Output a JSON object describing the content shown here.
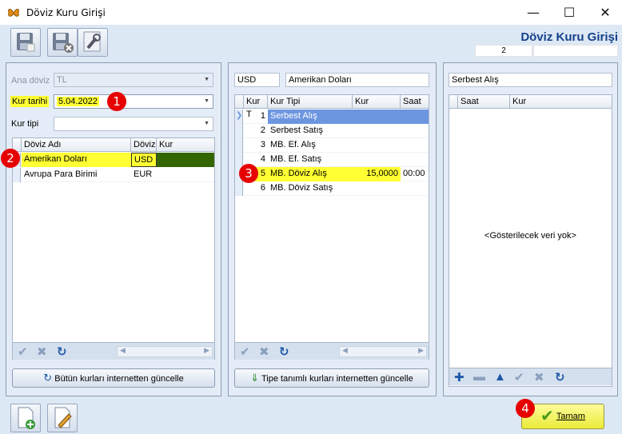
{
  "window": {
    "title": "Döviz Kuru Girişi"
  },
  "header": {
    "form_title": "Döviz Kuru Girişi",
    "record_number": "2"
  },
  "left": {
    "ana_doviz_label": "Ana döviz",
    "ana_doviz_value": "TL",
    "kur_tarihi_label": "Kur tarihi",
    "kur_tarihi_value": "5.04.2022",
    "kur_tipi_label": "Kur tipi",
    "kur_tipi_value": "",
    "columns": [
      "Döviz Adı",
      "Döviz",
      "Kur"
    ],
    "rows": [
      {
        "name": "Amerikan Doları",
        "code": "USD",
        "rate": ""
      },
      {
        "name": "Avrupa Para Birimi",
        "code": "EUR",
        "rate": ""
      }
    ],
    "update_all_button": "Bütün kurları internetten güncelle"
  },
  "middle": {
    "currency_code": "USD",
    "currency_name": "Amerikan Doları",
    "columns": [
      "Kur T",
      "Kur Tipi",
      "Kur",
      "Saat"
    ],
    "rows": [
      {
        "no": "1",
        "type": "Serbest Alış",
        "rate": "",
        "time": ""
      },
      {
        "no": "2",
        "type": "Serbest Satış",
        "rate": "",
        "time": ""
      },
      {
        "no": "3",
        "type": "MB. Ef. Alış",
        "rate": "",
        "time": ""
      },
      {
        "no": "4",
        "type": "MB. Ef. Satış",
        "rate": "",
        "time": ""
      },
      {
        "no": "5",
        "type": "MB. Döviz Alış",
        "rate": "15,0000",
        "time": "00:00"
      },
      {
        "no": "6",
        "type": "MB. Döviz Satış",
        "rate": "",
        "time": ""
      }
    ],
    "update_typed_button": "Tipe tanımlı kurları internetten güncelle"
  },
  "right": {
    "selected_type": "Serbest Alış",
    "columns": [
      "Saat",
      "Kur"
    ],
    "empty_text": "<Gösterilecek veri yok>"
  },
  "footer": {
    "ok_button": "Tamam"
  },
  "badges": [
    "1",
    "2",
    "3",
    "4"
  ],
  "colors": {
    "highlight": "#ffff33",
    "selected_rate": "#336600",
    "selected_row": "#6d96e0",
    "badge": "#e60000",
    "title": "#15428b"
  }
}
